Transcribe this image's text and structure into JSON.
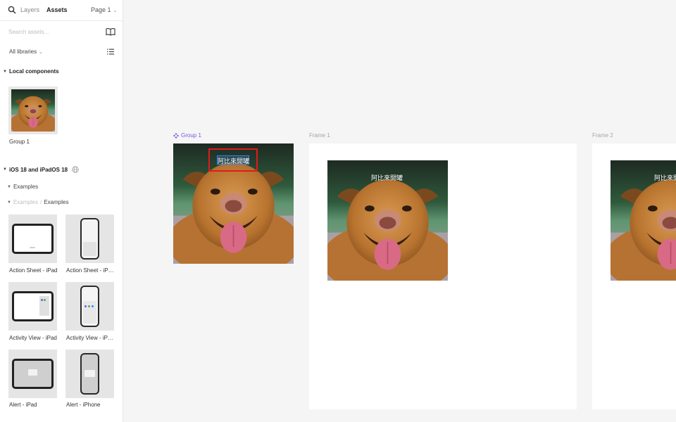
{
  "sidebar": {
    "tabs": {
      "layers": "Layers",
      "assets": "Assets",
      "page": "Page 1"
    },
    "search": {
      "placeholder": "Search assets..."
    },
    "library_selector": "All libraries",
    "local_components": {
      "heading": "Local components",
      "items": [
        {
          "label": "Group 1"
        }
      ]
    },
    "library": {
      "heading": "iOS 18 and iPadOS 18",
      "subgroup": "Examples",
      "breadcrumb": {
        "parent": "Examples",
        "current": "Examples"
      },
      "items": [
        {
          "label": "Action Sheet - iPad"
        },
        {
          "label": "Action Sheet - iPhone"
        },
        {
          "label": "Activity View - iPad"
        },
        {
          "label": "Activity View - iPhone"
        },
        {
          "label": "Alert - iPad"
        },
        {
          "label": "Alert - iPhone"
        }
      ]
    }
  },
  "canvas": {
    "group": {
      "label": "Group 1",
      "caption": "阿比來開罐"
    },
    "frame1": {
      "label": "Frame 1",
      "caption": "阿比來開罐"
    },
    "frame2": {
      "label": "Frame 2",
      "caption": "阿比來開罐"
    }
  },
  "colors": {
    "accent_purple": "#7b57e8",
    "selection_red": "#e01b1b",
    "selection_blue": "#2f8cff"
  }
}
